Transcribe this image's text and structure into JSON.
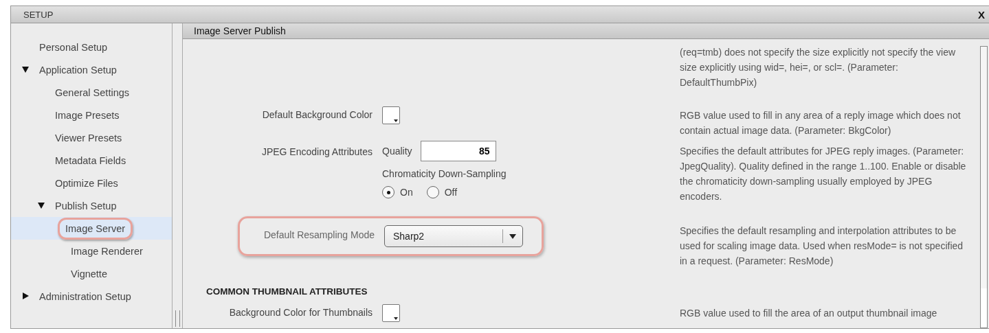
{
  "window": {
    "title": "SETUP",
    "close": "X"
  },
  "sidebar": {
    "items": [
      {
        "label": "Personal Setup",
        "selected": false
      },
      {
        "label": "Application Setup",
        "expanded": true,
        "selected": false,
        "children": [
          {
            "label": "General Settings",
            "selected": false
          },
          {
            "label": "Image Presets",
            "selected": false
          },
          {
            "label": "Viewer Presets",
            "selected": false
          },
          {
            "label": "Metadata Fields",
            "selected": false
          },
          {
            "label": "Optimize Files",
            "selected": false
          },
          {
            "label": "Publish Setup",
            "expanded": true,
            "selected": false,
            "children": [
              {
                "label": "Image Server",
                "selected": true,
                "highlighted": true
              },
              {
                "label": "Image Renderer",
                "selected": false
              },
              {
                "label": "Vignette",
                "selected": false
              }
            ]
          }
        ]
      },
      {
        "label": "Administration Setup",
        "expanded": false,
        "selected": false
      }
    ]
  },
  "panel": {
    "title": "Image Server Publish",
    "rows": [
      {
        "kind": "note",
        "description": "(req=tmb) does not specify the size explicitly not specify the view size explicitly using wid=, hei=, or scl=. (Parameter: DefaultThumbPix)"
      },
      {
        "kind": "color",
        "label": "Default Background Color",
        "description": "RGB value used to fill in any area of a reply image which does not contain actual image data. (Parameter: BkgColor)"
      },
      {
        "kind": "jpeg",
        "label": "JPEG Encoding Attributes",
        "quality_label": "Quality",
        "quality_value": "85",
        "chroma_label": "Chromaticity Down-Sampling",
        "options": [
          {
            "label": "On",
            "selected": true
          },
          {
            "label": "Off",
            "selected": false
          }
        ],
        "description": "Specifies the default attributes for JPEG reply images. (Parameter: JpegQuality). Quality defined in the range 1..100. Enable or disable the chromaticity down-sampling usually employed by JPEG encoders."
      },
      {
        "kind": "select",
        "label": "Default Resampling Mode",
        "value": "Sharp2",
        "highlighted": true,
        "description": "Specifies the default resampling and interpolation attributes to be used for scaling image data. Used when resMode= is not specified in a request. (Parameter: ResMode)"
      },
      {
        "kind": "heading",
        "label": "COMMON THUMBNAIL ATTRIBUTES"
      },
      {
        "kind": "color",
        "label": "Background Color for Thumbnails",
        "description": "RGB value used to fill the area of an output thumbnail image"
      }
    ]
  }
}
